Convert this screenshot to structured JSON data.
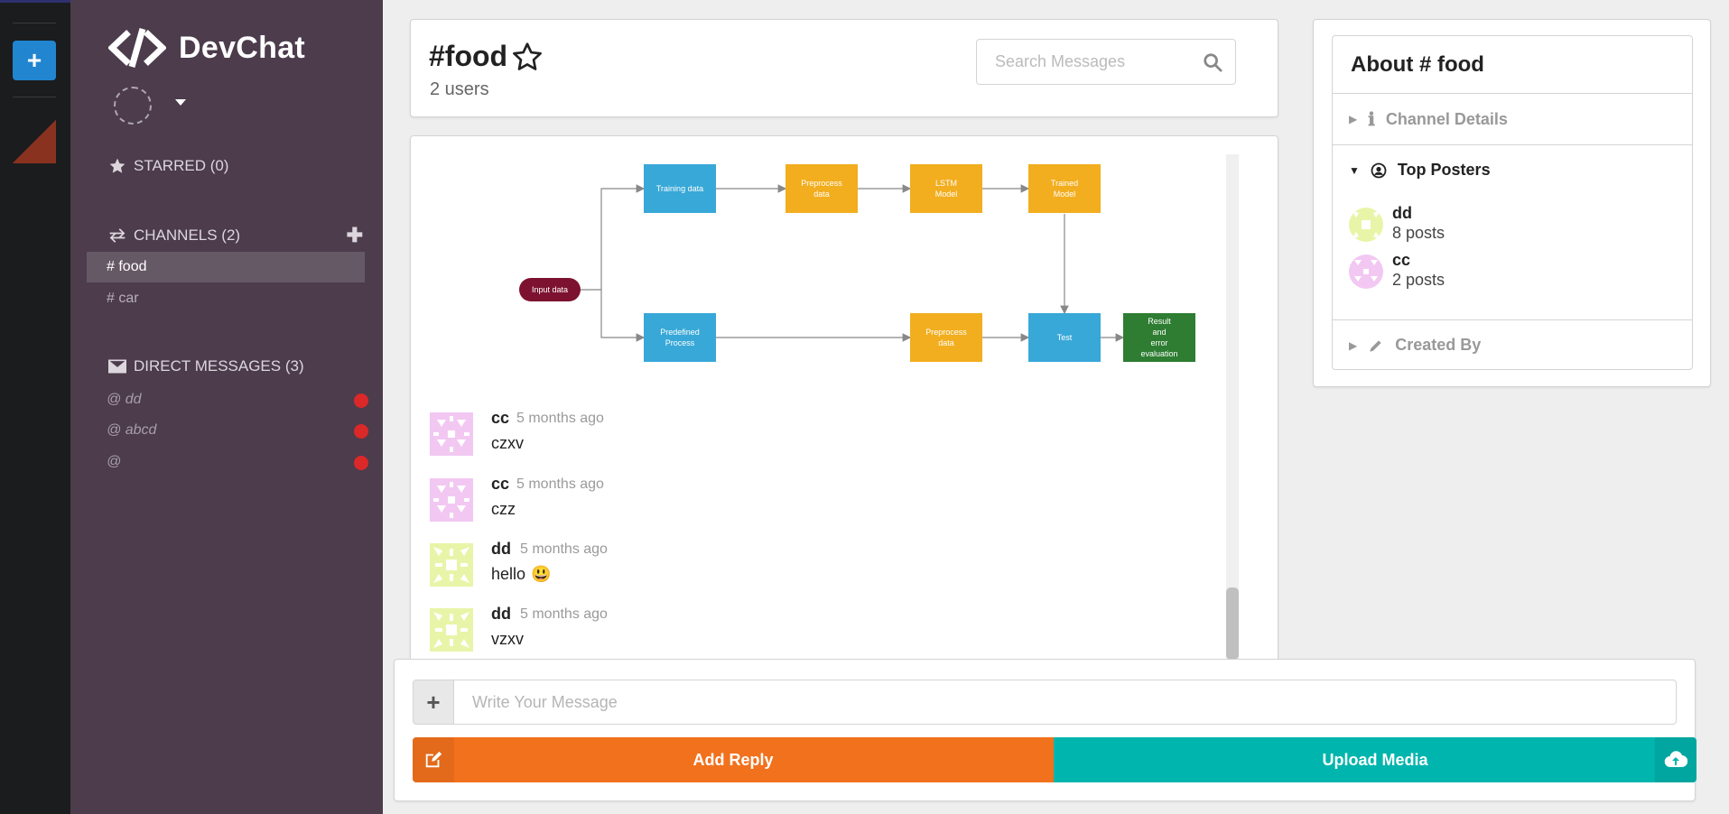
{
  "app": {
    "brand": "DevChat"
  },
  "rail": {
    "add_label": "+"
  },
  "sidebar": {
    "starred": {
      "label": "STARRED (0)"
    },
    "channels": {
      "label": "CHANNELS (2)",
      "items": [
        {
          "label": "# food",
          "active": true
        },
        {
          "label": "# car",
          "active": false
        }
      ]
    },
    "direct_messages": {
      "label": "DIRECT MESSAGES (3)",
      "items": [
        {
          "label": "@ dd"
        },
        {
          "label": "@ abcd"
        },
        {
          "label": "@"
        }
      ]
    }
  },
  "channel": {
    "title": "#food",
    "users": "2 users",
    "search_placeholder": "Search Messages"
  },
  "diagram": {
    "nodes": {
      "input": "Input data",
      "training": "Training data",
      "preprocess_top_1": "Preprocess",
      "preprocess_top_2": "data",
      "lstm_1": "LSTM",
      "lstm_2": "Model",
      "trained_1": "Trained",
      "trained_2": "Model",
      "predefined_1": "Predefined",
      "predefined_2": "Process",
      "preprocess_bot_1": "Preprocess",
      "preprocess_bot_2": "data",
      "test": "Test",
      "result_1": "Result",
      "result_2": "and",
      "result_3": "error",
      "result_4": "evaluation"
    }
  },
  "messages": [
    {
      "author": "cc",
      "time": "5 months ago",
      "text": "czxv"
    },
    {
      "author": "cc",
      "time": "5 months ago",
      "text": "czz"
    },
    {
      "author": "dd",
      "time": "5 months ago",
      "text": "hello",
      "emoji": "😃"
    },
    {
      "author": "dd",
      "time": "5 months ago",
      "text": "vzxv"
    }
  ],
  "composer": {
    "placeholder": "Write Your Message",
    "reply_label": "Add Reply",
    "upload_label": "Upload Media"
  },
  "about": {
    "title": "About # food",
    "channel_details": "Channel Details",
    "top_posters": "Top Posters",
    "created_by": "Created By",
    "posters": [
      {
        "name": "dd",
        "posts": "8 posts"
      },
      {
        "name": "cc",
        "posts": "2 posts"
      }
    ]
  },
  "colors": {
    "sidebar": "#4c3c4c",
    "rail": "#1b1c1d",
    "primary": "#2185d0",
    "reply": "#f2711c",
    "upload": "#00b5ad",
    "notify_dot": "#db2828",
    "avatar_cc": "#f2c8f2",
    "avatar_dd": "#e8f5a8"
  }
}
